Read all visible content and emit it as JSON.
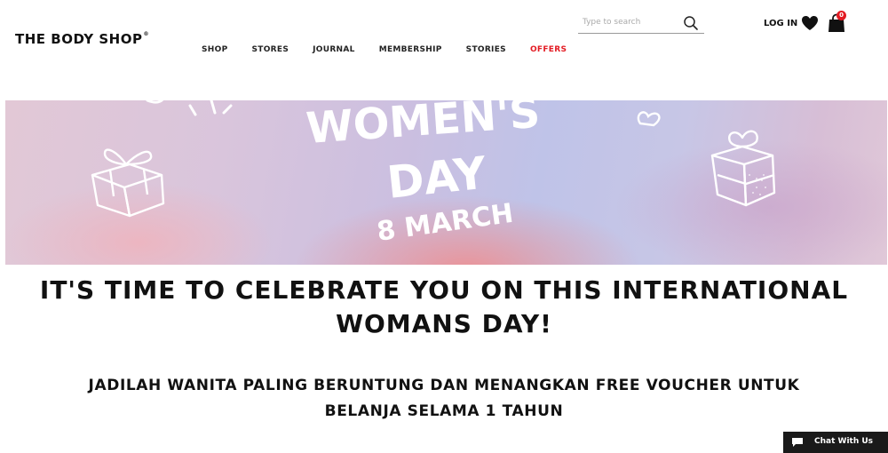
{
  "header": {
    "logo": "THE BODY SHOP",
    "logo_mark": "®",
    "nav": [
      {
        "label": "SHOP"
      },
      {
        "label": "STORES"
      },
      {
        "label": "JOURNAL"
      },
      {
        "label": "MEMBERSHIP"
      },
      {
        "label": "STORIES"
      },
      {
        "label": "OFFERS"
      }
    ],
    "search": {
      "placeholder": "Type to search",
      "value": ""
    },
    "login_label": "LOG IN",
    "cart_count": "0"
  },
  "banner": {
    "line1": "WOMEN'S",
    "line2": "DAY",
    "line3": "8 MARCH"
  },
  "main": {
    "headline_1": "IT'S TIME TO CELEBRATE YOU ON THIS INTERNATIONAL",
    "headline_2": "WOMANS DAY!",
    "sub_1": "JADILAH WANITA PALING BERUNTUNG DAN MENANGKAN FREE VOUCHER UNTUK",
    "sub_2": "BELANJA SELAMA 1 TAHUN"
  },
  "chat": {
    "label": "Chat With Us"
  },
  "colors": {
    "accent": "#e31b23",
    "text": "#111111",
    "chat_bg": "#1a1a1a"
  }
}
